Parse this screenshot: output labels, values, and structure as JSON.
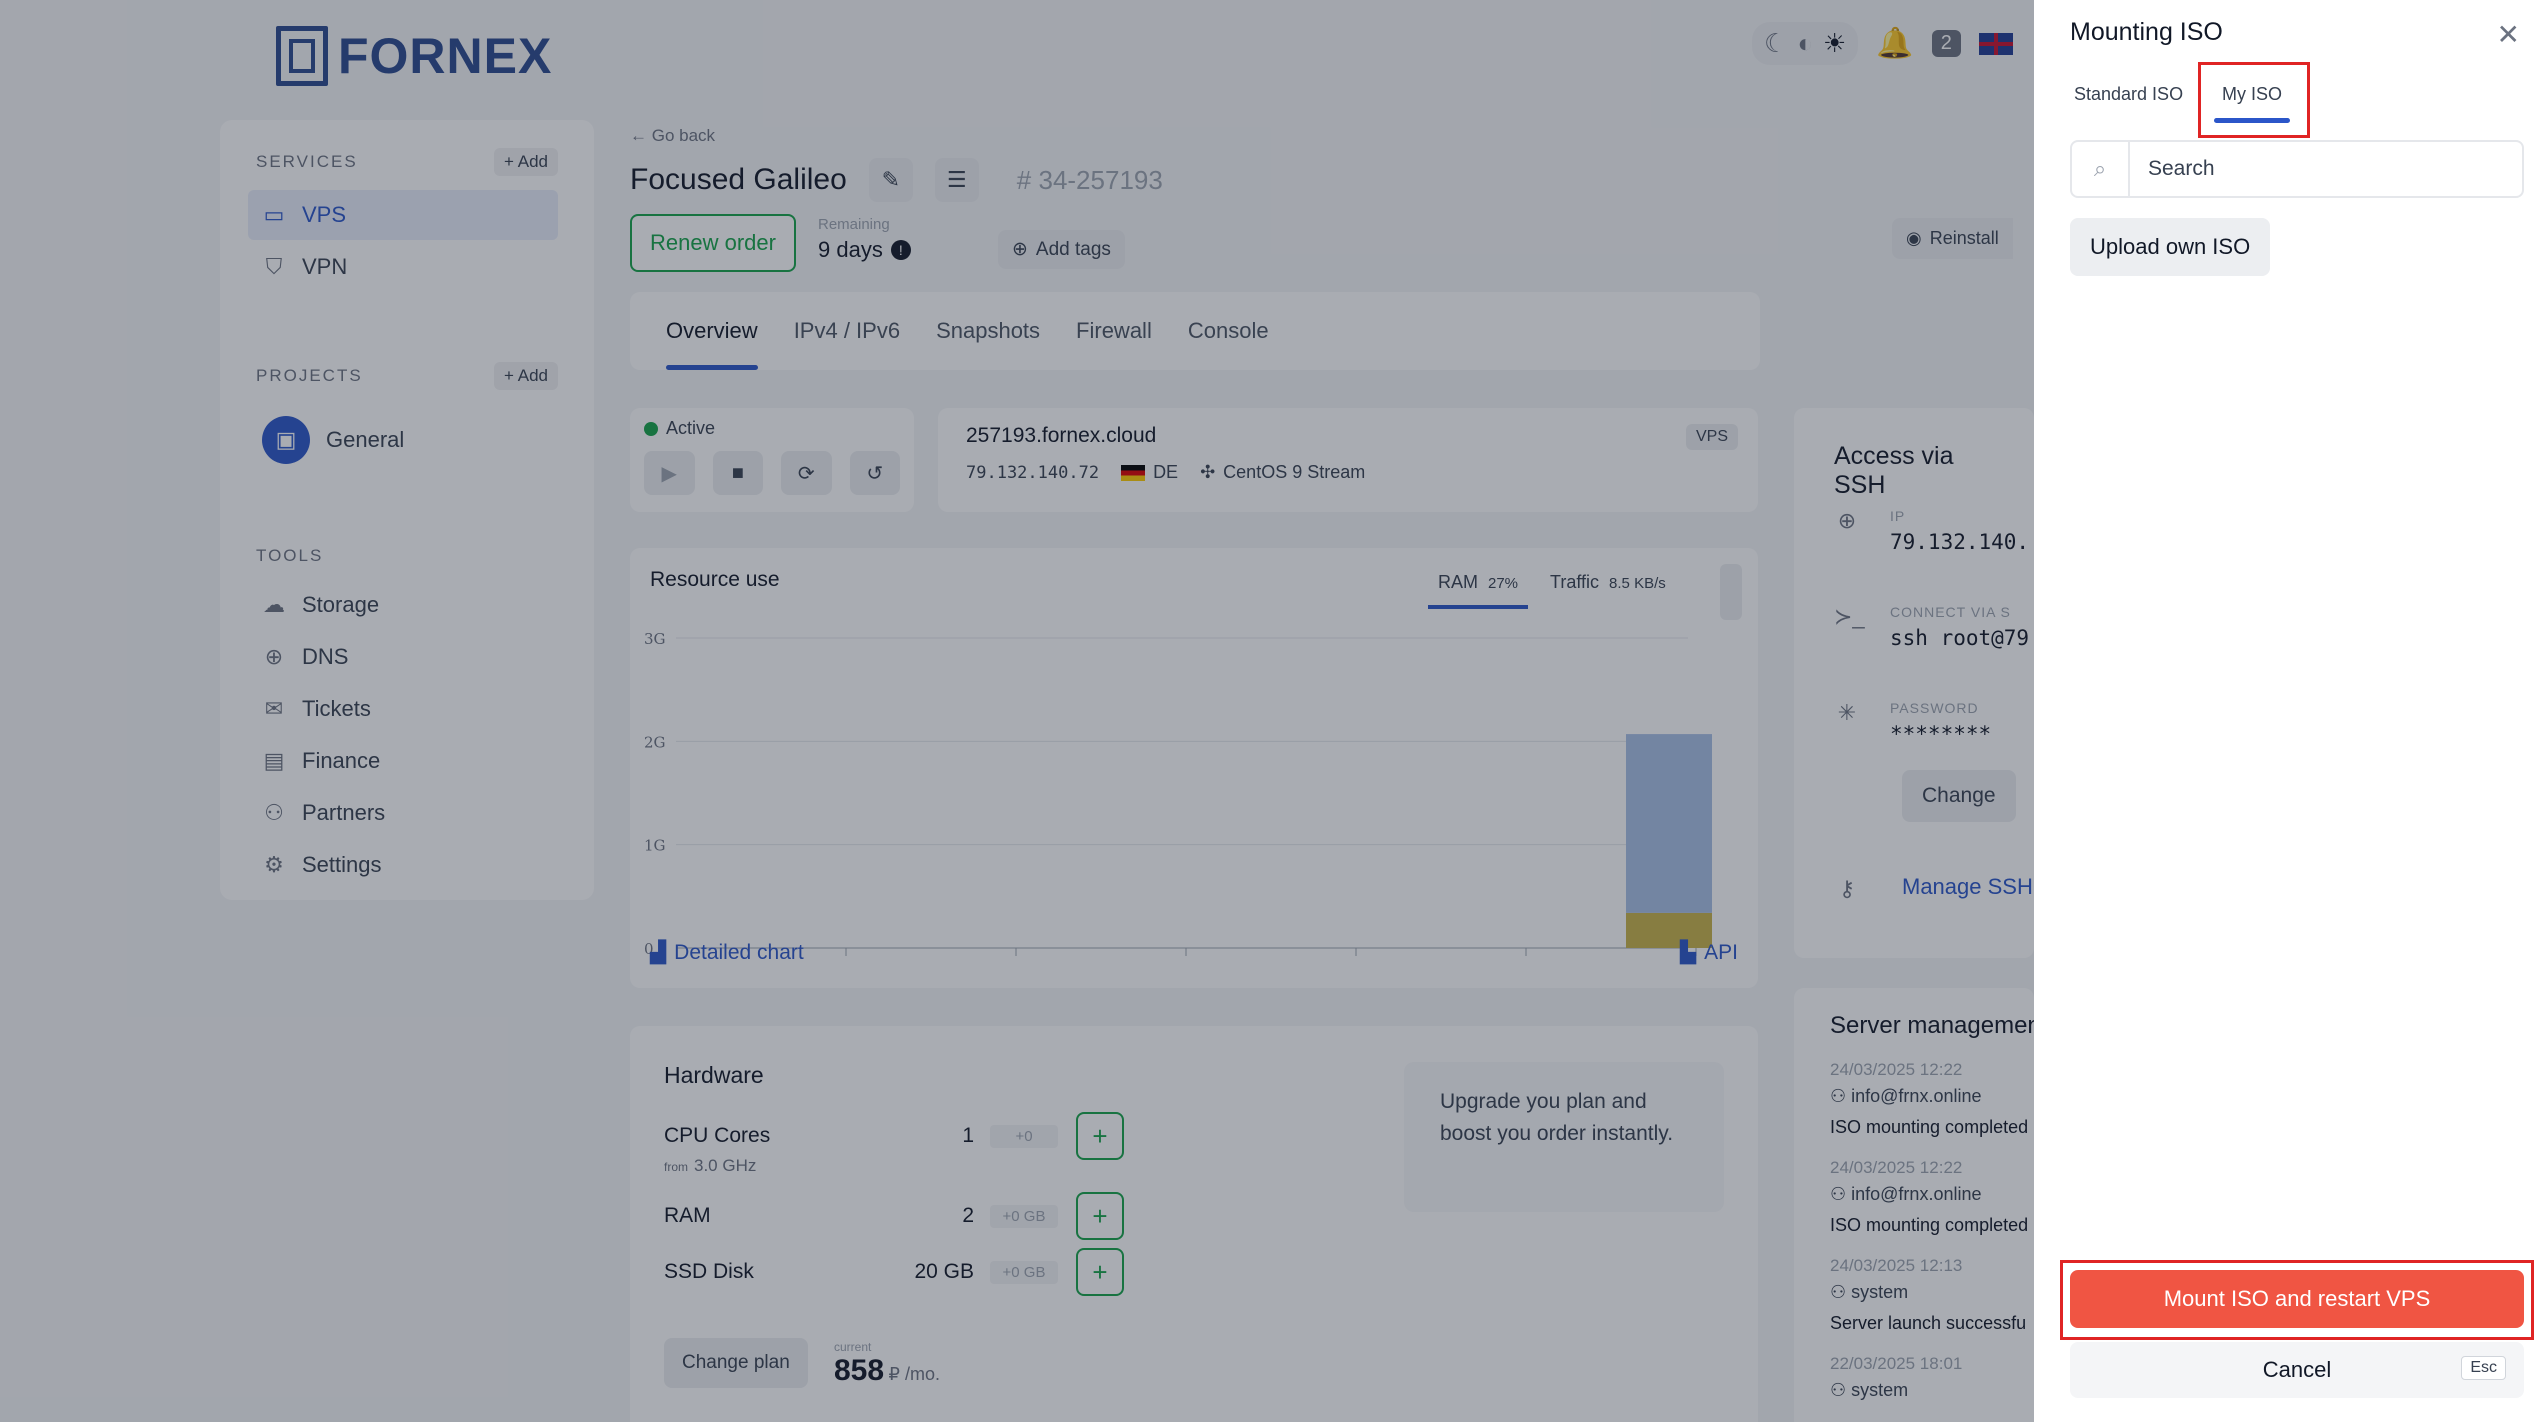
{
  "brand": {
    "name": "FORNEX"
  },
  "topbar": {
    "notifications_count": "2"
  },
  "sidebar": {
    "services_title": "SERVICES",
    "services_add": "+ Add",
    "services": [
      {
        "label": "VPS",
        "icon": "server-icon"
      },
      {
        "label": "VPN",
        "icon": "shield-icon"
      }
    ],
    "projects_title": "PROJECTS",
    "projects_add": "+ Add",
    "project": "General",
    "tools_title": "TOOLS",
    "tools": [
      {
        "label": "Storage",
        "icon": "cloud-icon"
      },
      {
        "label": "DNS",
        "icon": "globe-icon"
      },
      {
        "label": "Tickets",
        "icon": "chat-icon"
      },
      {
        "label": "Finance",
        "icon": "card-icon"
      },
      {
        "label": "Partners",
        "icon": "people-icon"
      },
      {
        "label": "Settings",
        "icon": "gear-icon"
      }
    ]
  },
  "main": {
    "go_back": "Go back",
    "title": "Focused Galileo",
    "order_number": "# 34-257193",
    "renew_label": "Renew order",
    "remaining_label": "Remaining",
    "remaining_value": "9 days",
    "add_tags": "Add tags",
    "reinstall": "Reinstall",
    "tabs": [
      "Overview",
      "IPv4 / IPv6",
      "Snapshots",
      "Firewall",
      "Console"
    ],
    "status": "Active",
    "hostname": "257193.fornex.cloud",
    "ip": "79.132.140.72",
    "country": "DE",
    "os": "CentOS 9 Stream",
    "vps_tag": "VPS"
  },
  "chart_data": {
    "type": "bar",
    "title": "Resource use",
    "tabs": [
      {
        "label": "RAM",
        "value": "27%"
      },
      {
        "label": "Traffic",
        "value": "8.5 KB/s"
      }
    ],
    "y_ticks": [
      "3G",
      "2G",
      "1G",
      "0"
    ],
    "ylim": [
      0,
      3
    ],
    "series": [
      {
        "values": [
          0.34
        ],
        "color": "#c9b44a"
      },
      {
        "values": [
          1.73
        ],
        "color": "#a9c0e6"
      }
    ],
    "links": {
      "detailed": "Detailed chart",
      "api": "API"
    }
  },
  "hardware": {
    "title": "Hardware",
    "rows": [
      {
        "label": "CPU Cores",
        "value": "1",
        "extra": "+0"
      },
      {
        "label": "RAM",
        "value": "2",
        "extra": "+0 GB"
      },
      {
        "label": "SSD Disk",
        "value": "20 GB",
        "extra": "+0 GB"
      }
    ],
    "cpu_sub_prefix": "from",
    "cpu_sub": "3.0 GHz",
    "upgrade_text": "Upgrade you plan and boost you order instantly.",
    "change_plan": "Change plan",
    "price_label": "current",
    "price": "858",
    "price_unit": "₽ /mo."
  },
  "ssh": {
    "title": "Access via SSH",
    "ip_label": "IP",
    "ip_value": "79.132.140.",
    "connect_label": "CONNECT VIA S",
    "connect_value": "ssh root@79",
    "password_label": "PASSWORD",
    "password_value": "********",
    "change": "Change",
    "manage": "Manage SSH"
  },
  "management": {
    "title": "Server managemen",
    "logs": [
      {
        "date": "24/03/2025 12:22",
        "user": "info@frnx.online",
        "msg": "ISO mounting completed"
      },
      {
        "date": "24/03/2025 12:22",
        "user": "info@frnx.online",
        "msg": "ISO mounting completed"
      },
      {
        "date": "24/03/2025 12:13",
        "user": "system",
        "msg": "Server launch successfu"
      },
      {
        "date": "22/03/2025 18:01",
        "user": "system",
        "msg": ""
      }
    ]
  },
  "panel": {
    "title": "Mounting ISO",
    "tabs": [
      "Standard ISO",
      "My ISO"
    ],
    "search_placeholder": "Search",
    "upload": "Upload own ISO",
    "mount": "Mount ISO and restart VPS",
    "cancel": "Cancel",
    "esc": "Esc",
    "accent": "#f05543"
  }
}
